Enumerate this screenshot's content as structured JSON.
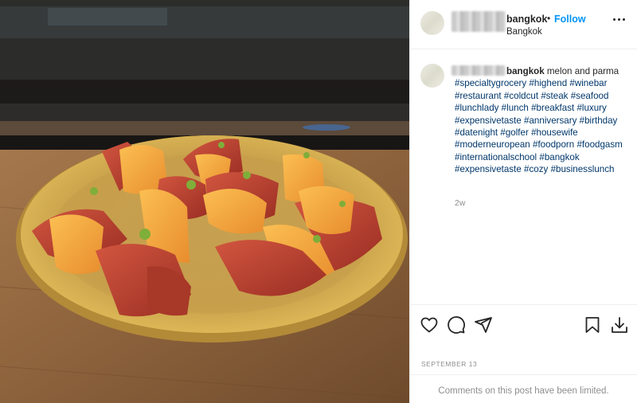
{
  "post": {
    "username": "bangkok",
    "follow_label": "Follow",
    "location": "Bangkok",
    "separator": "•"
  },
  "caption": {
    "username": "bangkok",
    "parts": [
      {
        "text": " melon and parma ",
        "tag": false
      },
      {
        "text": "#specialtygrocery",
        "tag": true
      },
      {
        "text": " ",
        "tag": false
      },
      {
        "text": "#highend",
        "tag": true
      },
      {
        "text": " ",
        "tag": false
      },
      {
        "text": "#winebar",
        "tag": true
      },
      {
        "text": " ",
        "tag": false
      },
      {
        "text": "#restaurant",
        "tag": true
      },
      {
        "text": " ",
        "tag": false
      },
      {
        "text": "#coldcut",
        "tag": true
      },
      {
        "text": " ",
        "tag": false
      },
      {
        "text": "#steak",
        "tag": true
      },
      {
        "text": " ",
        "tag": false
      },
      {
        "text": "#seafood",
        "tag": true
      },
      {
        "text": " ",
        "tag": false
      },
      {
        "text": "#lunchlady",
        "tag": true
      },
      {
        "text": " ",
        "tag": false
      },
      {
        "text": "#lunch",
        "tag": true
      },
      {
        "text": " ",
        "tag": false
      },
      {
        "text": "#breakfast",
        "tag": true
      },
      {
        "text": " ",
        "tag": false
      },
      {
        "text": "#luxury",
        "tag": true
      },
      {
        "text": " ",
        "tag": false
      },
      {
        "text": "#expensivetaste",
        "tag": true
      },
      {
        "text": " ",
        "tag": false
      },
      {
        "text": "#anniversary",
        "tag": true
      },
      {
        "text": " ",
        "tag": false
      },
      {
        "text": "#birthday",
        "tag": true
      },
      {
        "text": " ",
        "tag": false
      },
      {
        "text": "#datenight",
        "tag": true
      },
      {
        "text": " ",
        "tag": false
      },
      {
        "text": "#golfer",
        "tag": true
      },
      {
        "text": " ",
        "tag": false
      },
      {
        "text": "#housewife",
        "tag": true
      },
      {
        "text": " ",
        "tag": false
      },
      {
        "text": "#moderneuropean",
        "tag": true
      },
      {
        "text": " ",
        "tag": false
      },
      {
        "text": "#foodporn",
        "tag": true
      },
      {
        "text": " ",
        "tag": false
      },
      {
        "text": "#foodgasm",
        "tag": true
      },
      {
        "text": " ",
        "tag": false
      },
      {
        "text": "#internationalschool",
        "tag": true
      },
      {
        "text": " ",
        "tag": false
      },
      {
        "text": "#bangkok",
        "tag": true
      },
      {
        "text": " ",
        "tag": false
      },
      {
        "text": "#expensivetaste",
        "tag": true
      },
      {
        "text": " ",
        "tag": false
      },
      {
        "text": "#cozy",
        "tag": true
      },
      {
        "text": " ",
        "tag": false
      },
      {
        "text": "#businesslunch",
        "tag": true
      }
    ],
    "time_ago": "2w"
  },
  "actions": {
    "icons": [
      "heart-icon",
      "comment-icon",
      "share-icon",
      "bookmark-icon",
      "download-icon"
    ]
  },
  "date_label": "SEPTEMBER 13",
  "comments_limited": "Comments on this post have been limited.",
  "colors": {
    "link": "#0095f6",
    "hashtag": "#00376b",
    "muted": "#8e8e8e",
    "text": "#262626",
    "plate": "#d4ae4e",
    "melon": "#f2a23e",
    "ham": "#b8412f"
  }
}
